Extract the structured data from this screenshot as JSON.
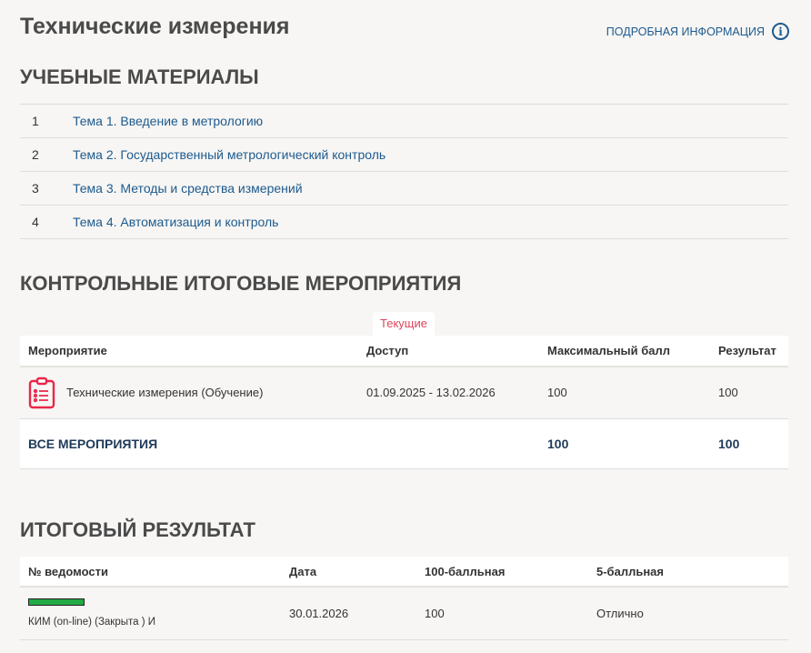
{
  "header": {
    "title": "Технические измерения",
    "more_label": "ПОДРОБНАЯ ИНФОРМАЦИЯ"
  },
  "materials": {
    "heading": "УЧЕБНЫЕ МАТЕРИАЛЫ",
    "items": [
      {
        "num": "1",
        "label": "Тема 1. Введение в метрологию"
      },
      {
        "num": "2",
        "label": "Тема 2. Государственный метрологический контроль"
      },
      {
        "num": "3",
        "label": "Тема 3. Методы и средства измерений"
      },
      {
        "num": "4",
        "label": "Тема 4. Автоматизация и контроль"
      }
    ]
  },
  "control": {
    "heading": "КОНТРОЛЬНЫЕ ИТОГОВЫЕ МЕРОПРИЯТИЯ",
    "tab": "Текущие",
    "columns": [
      "Мероприятие",
      "Доступ",
      "Максимальный балл",
      "Результат"
    ],
    "rows": [
      {
        "name": "Технические измерения (Обучение)",
        "access": "01.09.2025 - 13.02.2026",
        "max": "100",
        "result": "100"
      }
    ],
    "total": {
      "label": "ВСЕ МЕРОПРИЯТИЯ",
      "max": "100",
      "result": "100"
    }
  },
  "final": {
    "heading": "ИТОГОВЫЙ РЕЗУЛЬТАТ",
    "columns": [
      "№ ведомости",
      "Дата",
      "100-балльная",
      "5-балльная"
    ],
    "rows": [
      {
        "name": "КИМ (on-line) (Закрыта ) И",
        "date": "30.01.2026",
        "score100": "100",
        "score5": "Отлично",
        "bar_color": "#22aa44"
      }
    ]
  }
}
